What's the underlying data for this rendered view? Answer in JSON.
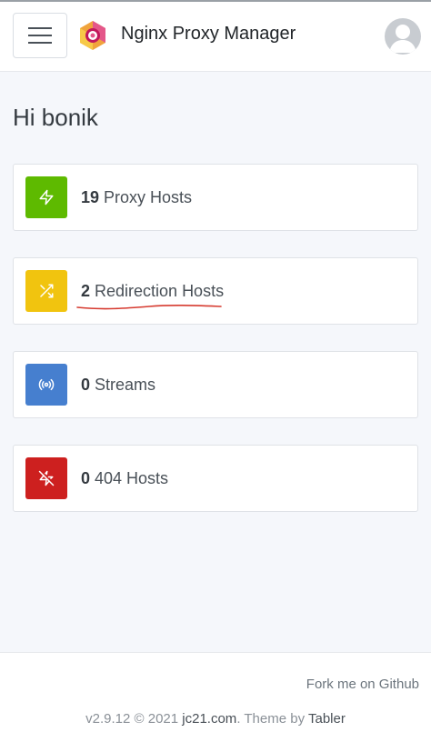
{
  "header": {
    "brand": "Nginx Proxy Manager"
  },
  "page": {
    "greeting": "Hi bonik"
  },
  "stats": [
    {
      "count": "19",
      "label": "Proxy Hosts",
      "color": "#5eba00",
      "icon": "lightning-icon"
    },
    {
      "count": "2",
      "label": "Redirection Hosts",
      "color": "#f1c40f",
      "icon": "shuffle-icon"
    },
    {
      "count": "0",
      "label": "Streams",
      "color": "#467fcf",
      "icon": "radio-icon"
    },
    {
      "count": "0",
      "label": "404 Hosts",
      "color": "#cd201f",
      "icon": "zap-off-icon"
    }
  ],
  "footer": {
    "fork_link": "Fork me on Github",
    "version": "v2.9.12 © 2021",
    "site_link": "jc21.com",
    "theme_text": ". Theme by",
    "theme_link": "Tabler"
  }
}
